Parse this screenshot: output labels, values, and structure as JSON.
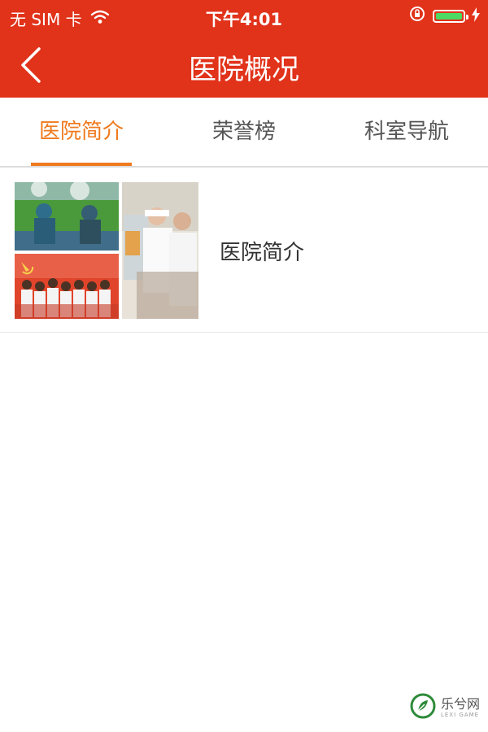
{
  "status_bar": {
    "carrier": "无 SIM 卡",
    "time": "下午4:01",
    "wifi_icon": "wifi-icon",
    "orientation_lock_icon": "orientation-lock-icon",
    "battery_icon": "battery-icon",
    "charging_icon": "charging-bolt-icon",
    "battery_level": 1.0
  },
  "nav_bar": {
    "title": "医院概况",
    "back_icon": "chevron-left-icon"
  },
  "tabs": [
    {
      "label": "医院简介",
      "active": true
    },
    {
      "label": "荣誉榜",
      "active": false
    },
    {
      "label": "科室导航",
      "active": false
    }
  ],
  "list": {
    "items": [
      {
        "title": "医院简介",
        "thumbnail": "hospital-collage-image"
      }
    ]
  },
  "watermark": {
    "logo": "lexi-game-logo",
    "text": "乐兮网",
    "subtext": "LEXI GAME"
  },
  "colors": {
    "brand": "#e1321a",
    "tab_active": "#ef7a1e",
    "battery": "#4cd964"
  }
}
